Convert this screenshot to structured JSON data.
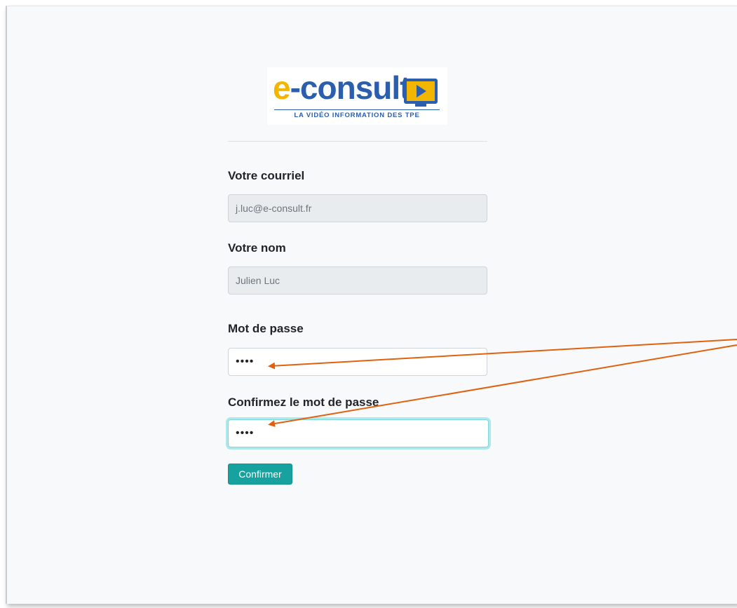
{
  "logo": {
    "brand_e": "e",
    "brand_dash": "-",
    "brand_rest": "consult",
    "tagline": "LA VIDÉO INFORMATION DES TPE",
    "colors": {
      "blue": "#2b5fad",
      "yellow": "#f2b600"
    }
  },
  "form": {
    "email_label": "Votre courriel",
    "email_value": "j.luc@e-consult.fr",
    "name_label": "Votre nom",
    "name_value": "Julien Luc",
    "password_label": "Mot de passe",
    "password_value": "••••",
    "confirm_label": "Confirmez le mot de passe",
    "confirm_value": "••••",
    "submit_label": "Confirmer"
  },
  "annotation": {
    "arrow_color": "#e0620f",
    "arrow_icon": "pointer-arrow-icon"
  },
  "colors": {
    "accent": "#17a2a0",
    "background": "#f8f9fa"
  }
}
